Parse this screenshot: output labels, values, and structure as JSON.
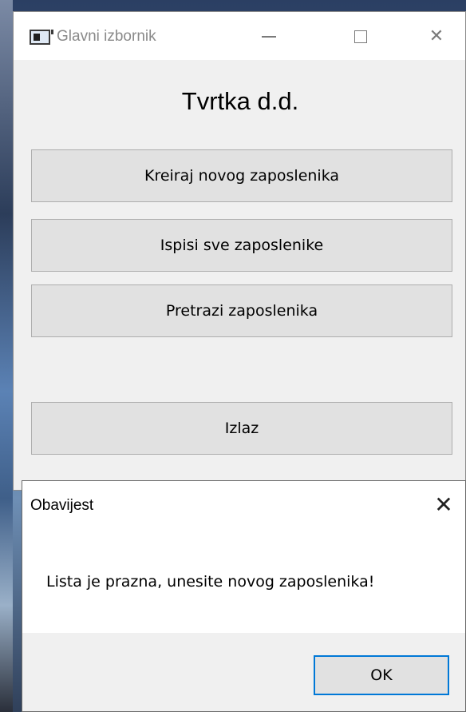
{
  "main_window": {
    "title": "Glavni izbornik",
    "icon": "app-window-icon",
    "controls": {
      "minimize": "minimize-icon",
      "maximize": "maximize-icon",
      "close_glyph": "✕"
    },
    "heading": "Tvrtka d.d.",
    "buttons": {
      "create": "Kreiraj novog zaposlenika",
      "list": "Ispisi sve zaposlenike",
      "search": "Pretrazi zaposlenika",
      "exit": "Izlaz"
    }
  },
  "dialog": {
    "title": "Obavijest",
    "close_glyph": "✕",
    "message": "Lista je prazna, unesite novog zaposlenika!",
    "ok_label": "OK"
  },
  "colors": {
    "window_bg": "#f0f0f0",
    "button_bg": "#e1e1e1",
    "focus_accent": "#0078d7"
  }
}
